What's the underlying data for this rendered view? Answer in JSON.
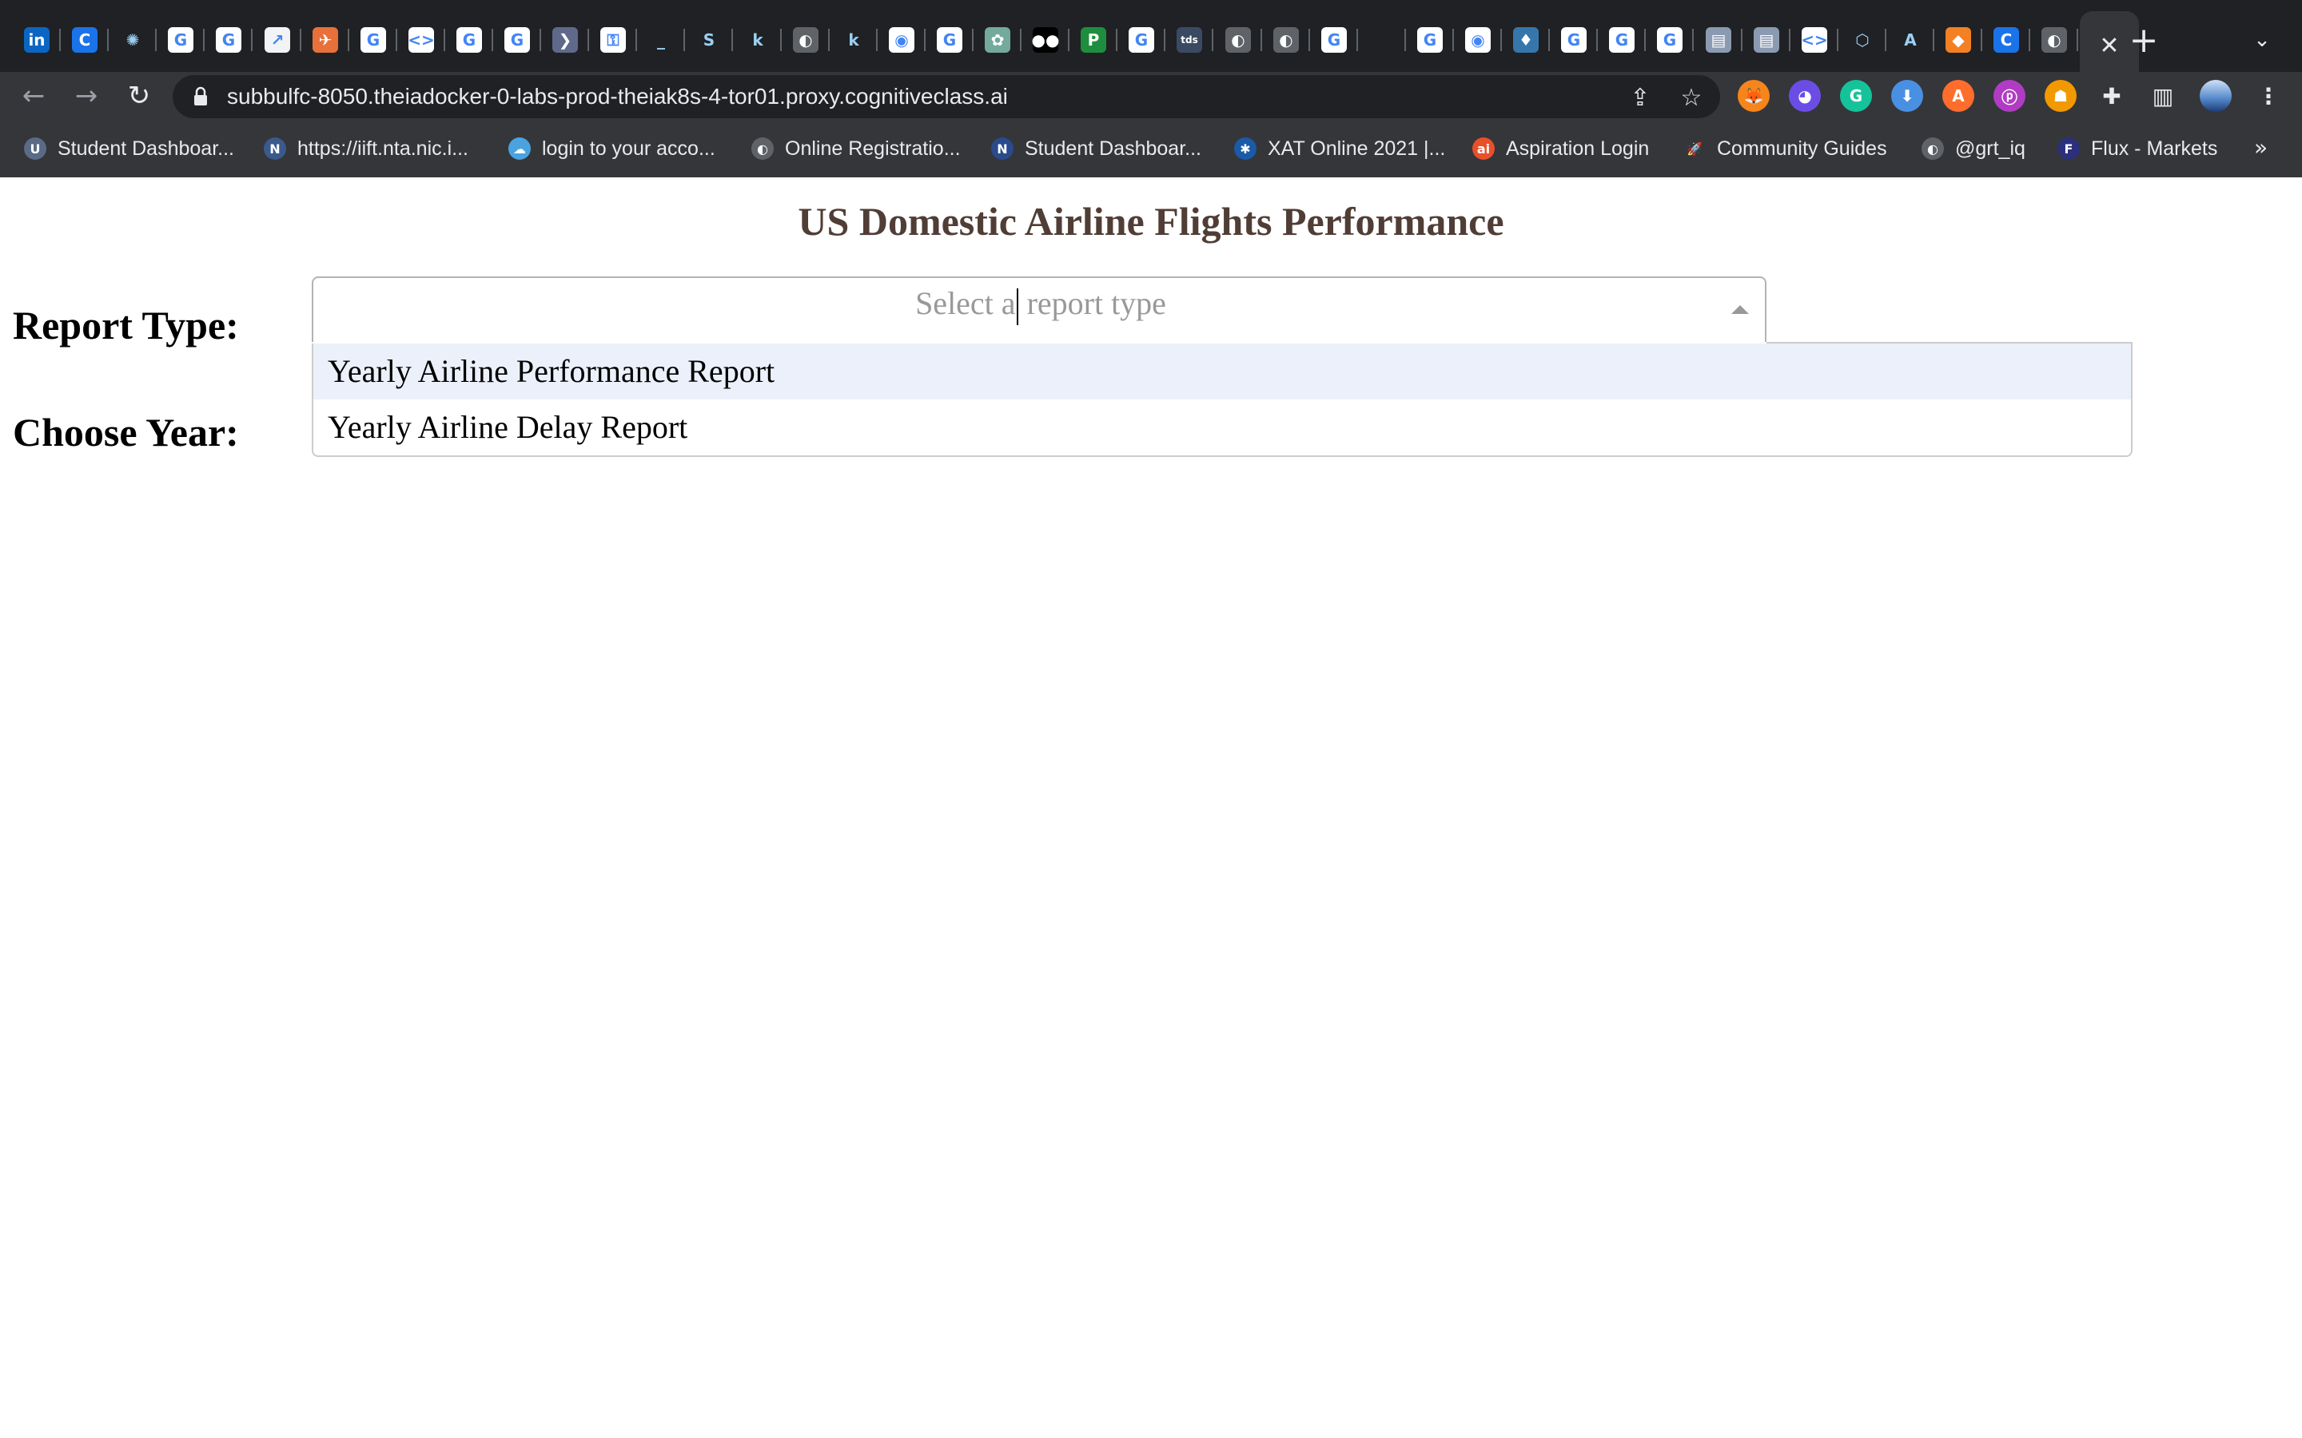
{
  "browser": {
    "tabs": [
      {
        "icon": "linkedin-icon",
        "glyph": "in",
        "color": "#0a66c2"
      },
      {
        "icon": "c-icon",
        "glyph": "C",
        "color": "#1a73e8"
      },
      {
        "icon": "bug-icon",
        "glyph": "✺",
        "color": "#202124"
      },
      {
        "icon": "google-icon",
        "glyph": "G",
        "color": "#ffffff"
      },
      {
        "icon": "google-icon",
        "glyph": "G",
        "color": "#ffffff"
      },
      {
        "icon": "chart-icon",
        "glyph": "↗",
        "color": "#f1f3f4"
      },
      {
        "icon": "plane-icon",
        "glyph": "✈",
        "color": "#e8703a"
      },
      {
        "icon": "google-icon",
        "glyph": "G",
        "color": "#ffffff"
      },
      {
        "icon": "code-icon",
        "glyph": "<>",
        "color": "#ffffff"
      },
      {
        "icon": "google-icon",
        "glyph": "G",
        "color": "#ffffff"
      },
      {
        "icon": "google-icon",
        "glyph": "G",
        "color": "#ffffff"
      },
      {
        "icon": "arrow-icon",
        "glyph": "❯",
        "color": "#5f6a8a"
      },
      {
        "icon": "lock-icon",
        "glyph": "⚿",
        "color": "#ffffff"
      },
      {
        "icon": "underscore-icon",
        "glyph": "_",
        "color": "#202124"
      },
      {
        "icon": "s-icon",
        "glyph": "S",
        "color": "#202124"
      },
      {
        "icon": "k-icon",
        "glyph": "k",
        "color": "#202124"
      },
      {
        "icon": "globe-icon",
        "glyph": "◐",
        "color": "#5f6368"
      },
      {
        "icon": "k-icon",
        "glyph": "k",
        "color": "#202124"
      },
      {
        "icon": "github-icon",
        "glyph": "◉",
        "color": "#ffffff"
      },
      {
        "icon": "google-icon",
        "glyph": "G",
        "color": "#ffffff"
      },
      {
        "icon": "openai-icon",
        "glyph": "✿",
        "color": "#74aa9c"
      },
      {
        "icon": "medium-icon",
        "glyph": "●●",
        "color": "#000000"
      },
      {
        "icon": "p-icon",
        "glyph": "P",
        "color": "#1e8e3e"
      },
      {
        "icon": "google-icon",
        "glyph": "G",
        "color": "#ffffff"
      },
      {
        "icon": "tds-icon",
        "glyph": "tds",
        "color": "#3b4a63"
      },
      {
        "icon": "globe-icon",
        "glyph": "◐",
        "color": "#5f6368"
      },
      {
        "icon": "globe-icon",
        "glyph": "◐",
        "color": "#5f6368"
      },
      {
        "icon": "google-icon",
        "glyph": "G",
        "color": "#ffffff"
      },
      {
        "icon": "apple-icon",
        "glyph": "",
        "color": "#202124"
      },
      {
        "icon": "google-icon",
        "glyph": "G",
        "color": "#ffffff"
      },
      {
        "icon": "github-icon",
        "glyph": "◉",
        "color": "#ffffff"
      },
      {
        "icon": "python-icon",
        "glyph": "♦",
        "color": "#3776ab"
      },
      {
        "icon": "google-icon",
        "glyph": "G",
        "color": "#ffffff"
      },
      {
        "icon": "google-icon",
        "glyph": "G",
        "color": "#ffffff"
      },
      {
        "icon": "google-icon",
        "glyph": "G",
        "color": "#ffffff"
      },
      {
        "icon": "document-icon",
        "glyph": "▤",
        "color": "#8a9ab0"
      },
      {
        "icon": "document-icon",
        "glyph": "▤",
        "color": "#8a9ab0"
      },
      {
        "icon": "code-icon",
        "glyph": "<>",
        "color": "#ffffff"
      },
      {
        "icon": "unity-icon",
        "glyph": "⬡",
        "color": "#202124"
      },
      {
        "icon": "a-icon",
        "glyph": "A",
        "color": "#202124"
      },
      {
        "icon": "diamond-icon",
        "glyph": "◆",
        "color": "#f48024"
      },
      {
        "icon": "c-icon",
        "glyph": "C",
        "color": "#1a73e8"
      },
      {
        "icon": "globe-icon",
        "glyph": "◐",
        "color": "#5f6368"
      }
    ],
    "active_tab_close": "✕",
    "new_tab": "+",
    "tab_menu": "⌄",
    "back": "←",
    "forward": "→",
    "reload": "↻",
    "url": "subbulfc-8050.theiadocker-0-labs-prod-theiak8s-4-tor01.proxy.cognitiveclass.ai",
    "share_icon": "⇪",
    "star_icon": "☆",
    "extensions": [
      {
        "icon": "metamask-icon",
        "glyph": "🦊",
        "color": "#f6851b"
      },
      {
        "icon": "extension-purple-icon",
        "glyph": "◕",
        "color": "#6b4de6"
      },
      {
        "icon": "grammarly-icon",
        "glyph": "G",
        "color": "#15c39a"
      },
      {
        "icon": "extension-blue-icon",
        "glyph": "⬇",
        "color": "#4a90e2"
      },
      {
        "icon": "extension-orange-icon",
        "glyph": "A",
        "color": "#ff6d2d"
      },
      {
        "icon": "extension-magenta-icon",
        "glyph": "ⓟ",
        "color": "#b03cc4"
      },
      {
        "icon": "extension-helmet-icon",
        "glyph": "☗",
        "color": "#f29900"
      },
      {
        "icon": "puzzle-icon",
        "glyph": "✚",
        "color": "#35363a"
      },
      {
        "icon": "sidepanel-icon",
        "glyph": "▥",
        "color": "#35363a"
      },
      {
        "icon": "profile-avatar-icon",
        "glyph": "",
        "color": "#7aa7e0"
      },
      {
        "icon": "kebab-menu-icon",
        "glyph": "⋮",
        "color": "#35363a"
      }
    ],
    "bookmarks": [
      {
        "label": "Student Dashboar...",
        "icon": "shield-icon",
        "glyph": "U",
        "color": "#5a6b86"
      },
      {
        "label": "https://iift.nta.nic.i...",
        "icon": "nta-icon",
        "glyph": "N",
        "color": "#3a5a8c"
      },
      {
        "label": "login to your acco...",
        "icon": "cloud-icon",
        "glyph": "☁",
        "color": "#4aa3df"
      },
      {
        "label": "Online Registratio...",
        "icon": "globe-icon",
        "glyph": "◐",
        "color": "#5f6368"
      },
      {
        "label": "Student Dashboar...",
        "icon": "nmat-icon",
        "glyph": "N",
        "color": "#2a4a8c"
      },
      {
        "label": "XAT Online 2021 |...",
        "icon": "xat-icon",
        "glyph": "✱",
        "color": "#1a5aa8"
      },
      {
        "label": "Aspiration Login",
        "icon": "ai-icon",
        "glyph": "ai",
        "color": "#e8502a"
      },
      {
        "label": "Community Guides",
        "icon": "rocket-icon",
        "glyph": "🚀",
        "color": "#35363a"
      },
      {
        "label": "@grt_iq",
        "icon": "globe-icon",
        "glyph": "◐",
        "color": "#5f6368"
      },
      {
        "label": "Flux - Markets",
        "icon": "flux-icon",
        "glyph": "F",
        "color": "#2c2f7a"
      }
    ],
    "bookmarks_more": "»"
  },
  "page": {
    "title": "US Domestic Airline Flights Performance",
    "report_type_label": "Report Type:",
    "choose_year_label": "Choose Year:",
    "report_dropdown": {
      "placeholder_before_caret": "Select a",
      "placeholder_after_caret": " report type",
      "options": [
        "Yearly Airline Performance Report",
        "Yearly Airline Delay Report"
      ],
      "focused_index": 0
    }
  }
}
